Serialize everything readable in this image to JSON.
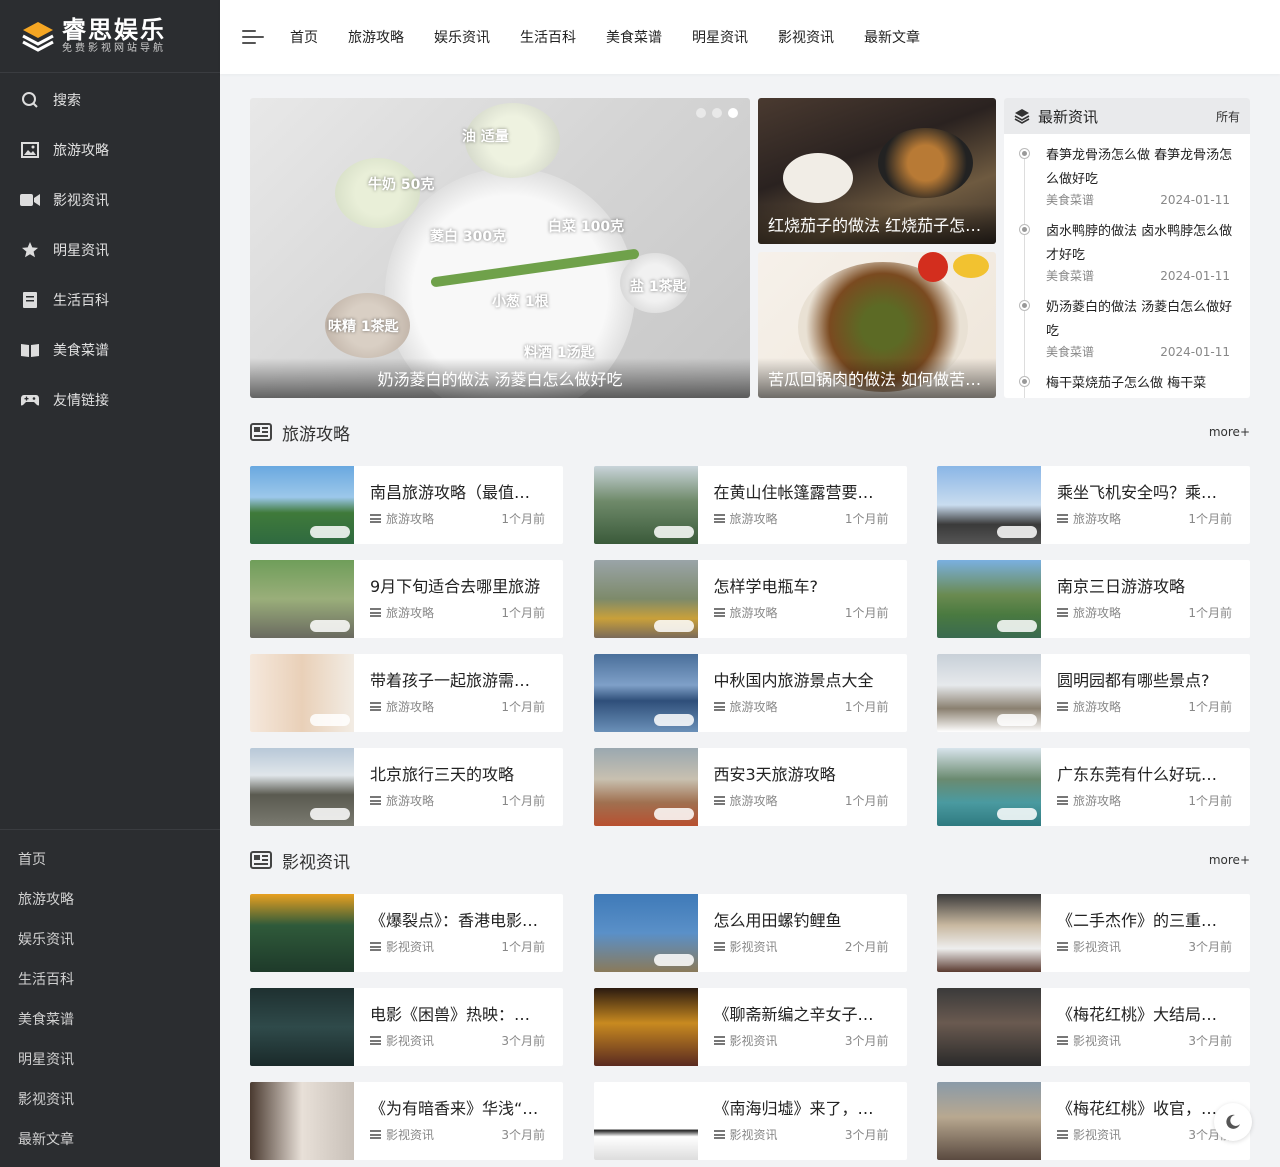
{
  "brand": {
    "title": "睿思娱乐",
    "subtitle": "免费影视网站导航"
  },
  "sidebar": {
    "items": [
      {
        "label": "搜索",
        "icon": "search-icon"
      },
      {
        "label": "旅游攻略",
        "icon": "image-icon"
      },
      {
        "label": "影视资讯",
        "icon": "video-icon"
      },
      {
        "label": "明星资讯",
        "icon": "star-icon"
      },
      {
        "label": "生活百科",
        "icon": "book-icon"
      },
      {
        "label": "美食菜谱",
        "icon": "open-book-icon"
      },
      {
        "label": "友情链接",
        "icon": "gamepad-icon"
      }
    ],
    "links": [
      "首页",
      "旅游攻略",
      "娱乐资讯",
      "生活百科",
      "美食菜谱",
      "明星资讯",
      "影视资讯",
      "最新文章"
    ]
  },
  "header": {
    "nav": [
      "首页",
      "旅游攻略",
      "娱乐资讯",
      "生活百科",
      "美食菜谱",
      "明星资讯",
      "影视资讯",
      "最新文章"
    ]
  },
  "hero": {
    "main": {
      "caption": "奶汤菱白的做法 汤菱白怎么做好吃",
      "labels": [
        "油 适量",
        "牛奶 50克",
        "菱白 300克",
        "白菜 100克",
        "盐 1茶匙",
        "小葱 1根",
        "味精 1茶匙",
        "料酒 1汤匙"
      ]
    },
    "side": [
      {
        "caption": "红烧茄子的做法 红烧茄子怎么做好吃"
      },
      {
        "caption": "苦瓜回锅肉的做法 如何做苦瓜回锅肉"
      }
    ]
  },
  "news": {
    "title": "最新资讯",
    "all": "所有",
    "items": [
      {
        "title": "春笋龙骨汤怎么做 春笋龙骨汤怎么做好吃",
        "cat": "美食菜谱",
        "date": "2024-01-11"
      },
      {
        "title": "卤水鸭脖的做法 卤水鸭脖怎么做才好吃",
        "cat": "美食菜谱",
        "date": "2024-01-11"
      },
      {
        "title": "奶汤菱白的做法 汤菱白怎么做好吃",
        "cat": "美食菜谱",
        "date": "2024-01-11"
      },
      {
        "title": "梅干菜烧茄子怎么做 梅干菜",
        "cat": "",
        "date": ""
      }
    ]
  },
  "sections": [
    {
      "name": "旅游攻略",
      "more": "more+",
      "cards": [
        {
          "title": "南昌旅游攻略（最值得去的景点）",
          "cat": "旅游攻略",
          "time": "1个月前"
        },
        {
          "title": "在黄山住帐篷露营要注意什么",
          "cat": "旅游攻略",
          "time": "1个月前"
        },
        {
          "title": "乘坐飞机安全吗？乘坐飞机注意事项",
          "cat": "旅游攻略",
          "time": "1个月前"
        },
        {
          "title": "9月下旬适合去哪里旅游",
          "cat": "旅游攻略",
          "time": "1个月前"
        },
        {
          "title": "怎样学电瓶车?",
          "cat": "旅游攻略",
          "time": "1个月前"
        },
        {
          "title": "南京三日游游攻略",
          "cat": "旅游攻略",
          "time": "1个月前"
        },
        {
          "title": "带着孩子一起旅游需要注意什么",
          "cat": "旅游攻略",
          "time": "1个月前"
        },
        {
          "title": "中秋国内旅游景点大全",
          "cat": "旅游攻略",
          "time": "1个月前"
        },
        {
          "title": "圆明园都有哪些景点?",
          "cat": "旅游攻略",
          "time": "1个月前"
        },
        {
          "title": "北京旅行三天的攻略",
          "cat": "旅游攻略",
          "time": "1个月前"
        },
        {
          "title": "西安3天旅游攻略",
          "cat": "旅游攻略",
          "time": "1个月前"
        },
        {
          "title": "广东东莞有什么好玩的地方",
          "cat": "旅游攻略",
          "time": "1个月前"
        }
      ]
    },
    {
      "name": "影视资讯",
      "more": "more+",
      "cards": [
        {
          "title": "《爆裂点》：香港电影新作上映",
          "cat": "影视资讯",
          "time": "1个月前"
        },
        {
          "title": "怎么用田螺钓鲤鱼",
          "cat": "影视资讯",
          "time": "2个月前"
        },
        {
          "title": "《二手杰作》的三重魔力",
          "cat": "影视资讯",
          "time": "3个月前"
        },
        {
          "title": "电影《困兽》热映：豪华阵容",
          "cat": "影视资讯",
          "time": "3个月前"
        },
        {
          "title": "《聊斋新编之辛女子》上线",
          "cat": "影视资讯",
          "time": "3个月前"
        },
        {
          "title": "《梅花红桃》大结局，真相揭晓",
          "cat": "影视资讯",
          "time": "3个月前"
        },
        {
          "title": "《为有暗香来》华浅“黑化”",
          "cat": "影视资讯",
          "time": "3个月前"
        },
        {
          "title": "《南海归墟》来了，新剧开播",
          "cat": "影视资讯",
          "time": "3个月前"
        },
        {
          "title": "《梅花红桃》收官，左文颖",
          "cat": "影视资讯",
          "time": "3个月前"
        }
      ]
    }
  ],
  "colors": {
    "sidebar": "#2b2d30",
    "accent": "#f5a623"
  }
}
